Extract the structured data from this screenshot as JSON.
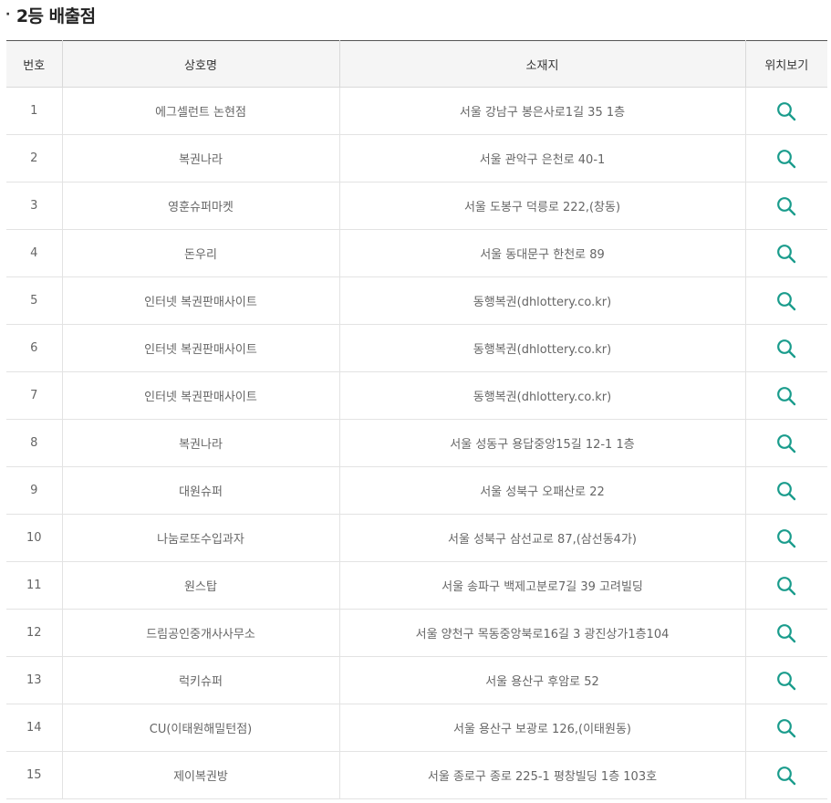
{
  "section": {
    "bullet": "·",
    "title": "2등 배출점"
  },
  "table": {
    "headers": [
      "번호",
      "상호명",
      "소재지",
      "위치보기"
    ],
    "rows": [
      {
        "no": "1",
        "name": "에그셀런트 논현점",
        "address": "서울 강남구 봉은사로1길 35 1층"
      },
      {
        "no": "2",
        "name": "복권나라",
        "address": "서울 관악구 은천로 40-1"
      },
      {
        "no": "3",
        "name": "영훈슈퍼마켓",
        "address": "서울 도봉구 덕릉로 222,(창동)"
      },
      {
        "no": "4",
        "name": "돈우리",
        "address": "서울 동대문구 한천로 89"
      },
      {
        "no": "5",
        "name": "인터넷 복권판매사이트",
        "address": "동행복권(dhlottery.co.kr)"
      },
      {
        "no": "6",
        "name": "인터넷 복권판매사이트",
        "address": "동행복권(dhlottery.co.kr)"
      },
      {
        "no": "7",
        "name": "인터넷 복권판매사이트",
        "address": "동행복권(dhlottery.co.kr)"
      },
      {
        "no": "8",
        "name": "복권나라",
        "address": "서울 성동구 용답중앙15길 12-1 1층"
      },
      {
        "no": "9",
        "name": "대원슈퍼",
        "address": "서울 성북구 오패산로 22"
      },
      {
        "no": "10",
        "name": "나눔로또수입과자",
        "address": "서울 성북구 삼선교로 87,(삼선동4가)"
      },
      {
        "no": "11",
        "name": "원스탑",
        "address": "서울 송파구 백제고분로7길 39 고려빌딩"
      },
      {
        "no": "12",
        "name": "드림공인중개사사무소",
        "address": "서울 양천구 목동중앙북로16길 3 광진상가1층104"
      },
      {
        "no": "13",
        "name": "럭키슈퍼",
        "address": "서울 용산구 후암로 52"
      },
      {
        "no": "14",
        "name": "CU(이태원해밀턴점)",
        "address": "서울 용산구 보광로 126,(이태원동)"
      },
      {
        "no": "15",
        "name": "제이복권방",
        "address": "서울 종로구 종로 225-1 평창빌딩 1층 103호"
      }
    ],
    "map_icon": "search-icon",
    "colors": {
      "icon": "#1a9c8c",
      "header_bg": "#f5f5f5",
      "top_border": "#555555"
    }
  }
}
